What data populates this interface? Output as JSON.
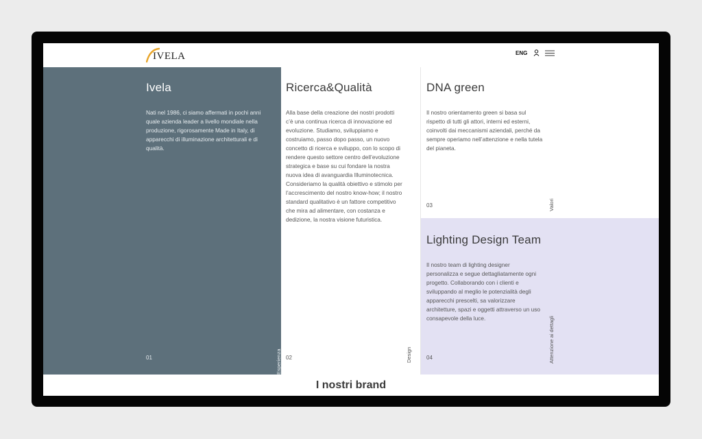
{
  "header": {
    "logo_text": "IVELA",
    "lang": "ENG"
  },
  "cards": [
    {
      "title": "Ivela",
      "text": "Nati nel 1986, ci siamo affermati in pochi anni quale azienda leader a livello mondiale nella produzione, rigorosamente Made in Italy, di apparecchi di illuminazione architetturali e di qualità.",
      "number": "01",
      "side": "Esperienza"
    },
    {
      "title": "Ricerca&Qualità",
      "text": "Alla base della creazione dei nostri prodotti c’è una continua ricerca di innovazione ed evoluzione. Studiamo, sviluppiamo e costruiamo, passo dopo passo, un nuovo concetto di ricerca e sviluppo, con lo scopo di rendere questo settore centro dell’evoluzione strategica e base su cui fondare la nostra nuova idea di avanguardia Illuminotecnica. Consideriamo la qualità obiettivo e stimolo per l’accrescimento del nostro know-how; il nostro standard qualitativo è un fattore competitivo che mira ad alimentare, con costanza e dedizione, la nostra visione futuristica.",
      "number": "02",
      "side": "Design"
    },
    {
      "title": "DNA green",
      "text": "Il nostro orientamento green si basa sul rispetto di tutti gli attori, interni ed esterni, coinvolti dai meccanismi aziendali, perché da sempre operiamo nell’attenzione e nella tutela del pianeta.",
      "number": "03",
      "side": "Valori"
    },
    {
      "title": "Lighting Design Team",
      "text": "Il nostro team di lighting designer personalizza e segue dettagliatamente ogni progetto. Collaborando con i clienti e sviluppando al meglio le potenzialità degli apparecchi prescelti, sa valorizzare architetture, spazi e oggetti attraverso un uso consapevole della luce.",
      "number": "04",
      "side": "Attenzione ai dettagli"
    }
  ],
  "brands": {
    "heading": "I nostri brand"
  },
  "colors": {
    "slate_panel": "#5d707b",
    "lavender_panel": "#e3e1f3",
    "logo_accent": "#e8a52a"
  }
}
